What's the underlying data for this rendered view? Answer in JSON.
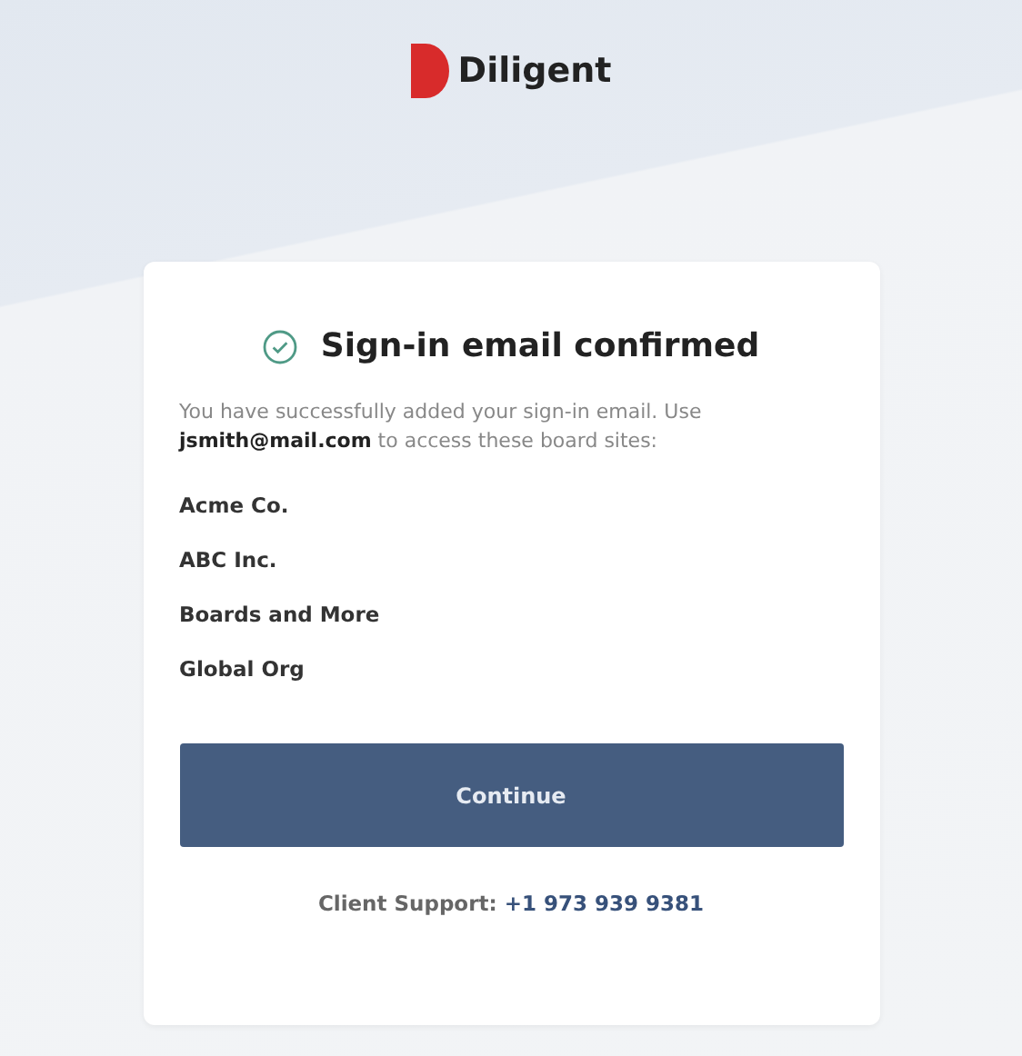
{
  "brand": {
    "name": "Diligent"
  },
  "card": {
    "title": "Sign-in email confirmed",
    "message": "You have successfully added your sign-in email. Use **jsmith@mail.com** to access these board sites:",
    "sites": [
      "Acme Co.",
      "ABC Inc.",
      "Boards and More",
      "Global Org"
    ],
    "button": "Continue",
    "support_label": "Client Support:",
    "support_phone": "+1 973 939 9381"
  }
}
